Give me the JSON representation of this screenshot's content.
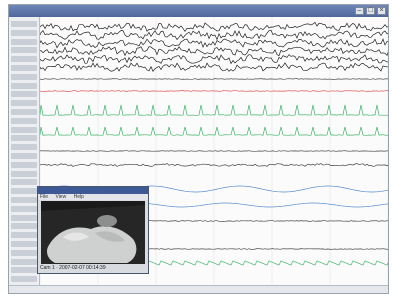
{
  "app": {
    "title": "",
    "accent_color": "#4f679c"
  },
  "channels": {
    "label_color": "#c9ced7",
    "trace_colors": {
      "eeg": "#222222",
      "ekg": "#e05050",
      "emg": "#3fb36a",
      "resp": "#5a8fd0",
      "limb": "#444444"
    }
  },
  "video_window": {
    "title": "",
    "menu_items": [
      "File",
      "View",
      "Help"
    ],
    "status": "Cam 1 · 2007-02-07 00:14:39"
  },
  "icons": {
    "minimize": "minimize-icon",
    "maximize": "maximize-icon",
    "close": "close-icon"
  }
}
